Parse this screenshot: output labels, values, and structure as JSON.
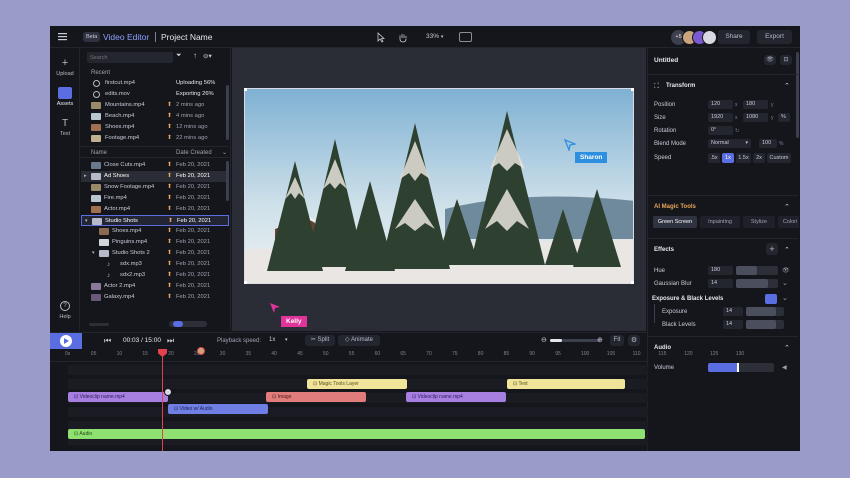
{
  "topbar": {
    "beta": "Beta",
    "app_title": "Video Editor",
    "project_name": "Project Name",
    "zoom": "33%",
    "avatar_extra": "+5",
    "share_label": "Share",
    "export_label": "Export"
  },
  "rail": {
    "upload": "Upload",
    "assets": "Assets",
    "text": "Text",
    "help": "Help"
  },
  "library": {
    "search_placeholder": "Search",
    "recent_label": "Recent",
    "recent": [
      {
        "name": "firstcut.mp4",
        "status": "Uploading 56%"
      },
      {
        "name": "edits.mov",
        "status": "Exporting 26%"
      },
      {
        "name": "Mountains.mp4",
        "status": "2 mins ago"
      },
      {
        "name": "Beach.mp4",
        "status": "4 mins ago"
      },
      {
        "name": "Shoes.mp4",
        "status": "12 mins ago"
      },
      {
        "name": "Footage.mp4",
        "status": "22 mins ago"
      }
    ],
    "col_name": "Name",
    "col_date": "Date Created",
    "files": [
      {
        "name": "Close Cuts.mp4",
        "date": "Feb 20, 2021"
      },
      {
        "name": "Ad Shoes",
        "date": "Feb 20, 2021"
      },
      {
        "name": "Snow Footage.mp4",
        "date": "Feb 20, 2021"
      },
      {
        "name": "Fire.mp4",
        "date": "Feb 20, 2021"
      },
      {
        "name": "Actor.mp4",
        "date": "Feb 20, 2021"
      },
      {
        "name": "Studio Shots",
        "date": "Feb 20, 2021"
      },
      {
        "name": "Shoes.mp4",
        "date": "Feb 20, 2021"
      },
      {
        "name": "Pinguins.mp4",
        "date": "Feb 20, 2021"
      },
      {
        "name": "Studio Shots 2",
        "date": "Feb 20, 2021"
      },
      {
        "name": "sdx.mp3",
        "date": "Feb 20, 2021"
      },
      {
        "name": "sdx2.mp3",
        "date": "Feb 20, 2021"
      },
      {
        "name": "Actor 2.mp4",
        "date": "Feb 20, 2021"
      },
      {
        "name": "Galaxy.mp4",
        "date": "Feb 20, 2021"
      }
    ]
  },
  "preview": {
    "cursor_sharon": "Sharon",
    "cursor_kelly": "Kelly"
  },
  "props": {
    "title": "Untitled",
    "transform_label": "Transform",
    "position_label": "Position",
    "pos_x": "120",
    "pos_y": "180",
    "size_label": "Size",
    "size_w": "1920",
    "size_h": "1080",
    "size_pct": "%",
    "rotation_label": "Rotation",
    "rotation_val": "0°",
    "blend_label": "Blend Mode",
    "blend_val": "Normal",
    "blend_pct": "100",
    "speed_label": "Speed",
    "speed_opts": [
      ".5x",
      "1x",
      "1.5x",
      "2x",
      "Custom"
    ],
    "ai_label": "AI Magic Tools",
    "ai_tabs": [
      "Green Screen",
      "Inpainting",
      "Stylize",
      "Colori"
    ],
    "effects_label": "Effects",
    "hue_label": "Hue",
    "hue_val": "180",
    "blur_label": "Gaussian Blur",
    "blur_val": "14",
    "exposure_group_label": "Exposure & Black Levels",
    "exposure_label": "Exposure",
    "exposure_val": "14",
    "black_label": "Black Levels",
    "black_val": "14",
    "audio_label": "Audio",
    "volume_label": "Volume"
  },
  "timeline": {
    "time": "00:03 / 15:00",
    "playback_label": "Playback speed:",
    "playback_val": "1x",
    "split_label": "Split",
    "animate_label": "Animate",
    "fit_label": "Fit",
    "ruler": [
      "0s",
      "05",
      "10",
      "15",
      "20",
      "25",
      "30",
      "35",
      "40",
      "45",
      "50",
      "55",
      "60",
      "65",
      "70",
      "75",
      "80",
      "85",
      "90",
      "95",
      "100",
      "105",
      "110",
      "115",
      "120",
      "125",
      "130"
    ],
    "clips": {
      "magic": "Magic Tools Layer",
      "text": "Text",
      "v1": "Videoclip name.mp4",
      "image": "Image",
      "v2": "Videoclip name.mp4",
      "audio_video": "Video w/ Audio",
      "audio": "Audio"
    }
  },
  "colors": {
    "accent": "#5b6ee1",
    "playhead": "#e0434b",
    "purple_clip": "#a77fe0",
    "red_clip": "#e07c7c",
    "yellow_clip": "#efe49a",
    "blue_clip": "#6f7fe4",
    "green_clip": "#8ee070",
    "sharon": "#2e8fe0",
    "kelly": "#e0349a"
  }
}
